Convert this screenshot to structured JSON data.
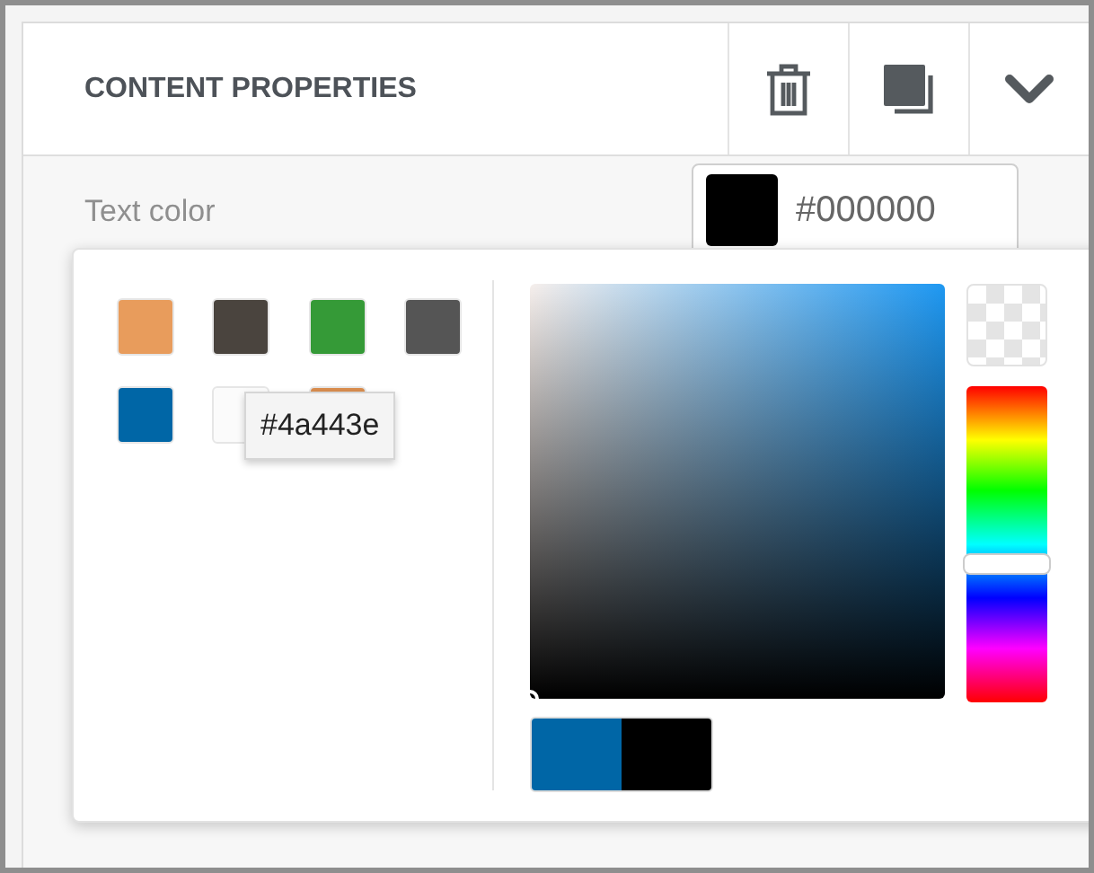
{
  "panel": {
    "title": "CONTENT PROPERTIES",
    "actions": [
      {
        "kind": "delete"
      },
      {
        "kind": "duplicate"
      },
      {
        "kind": "collapse"
      }
    ]
  },
  "text_color": {
    "label": "Text color",
    "value": "#000000",
    "color": "#000000"
  },
  "picker": {
    "swatches": [
      {
        "color": "#e89c5c"
      },
      {
        "color": "#4a443e"
      },
      {
        "color": "#359a37"
      },
      {
        "color": "#555555"
      },
      {
        "color": "#0066a6"
      },
      {
        "color": "#fbfbfb"
      },
      {
        "color": "#d98d4e"
      }
    ],
    "tooltip": "#4a443e",
    "current": {
      "color": "#0066a6"
    },
    "previous": {
      "color": "#000000"
    }
  }
}
